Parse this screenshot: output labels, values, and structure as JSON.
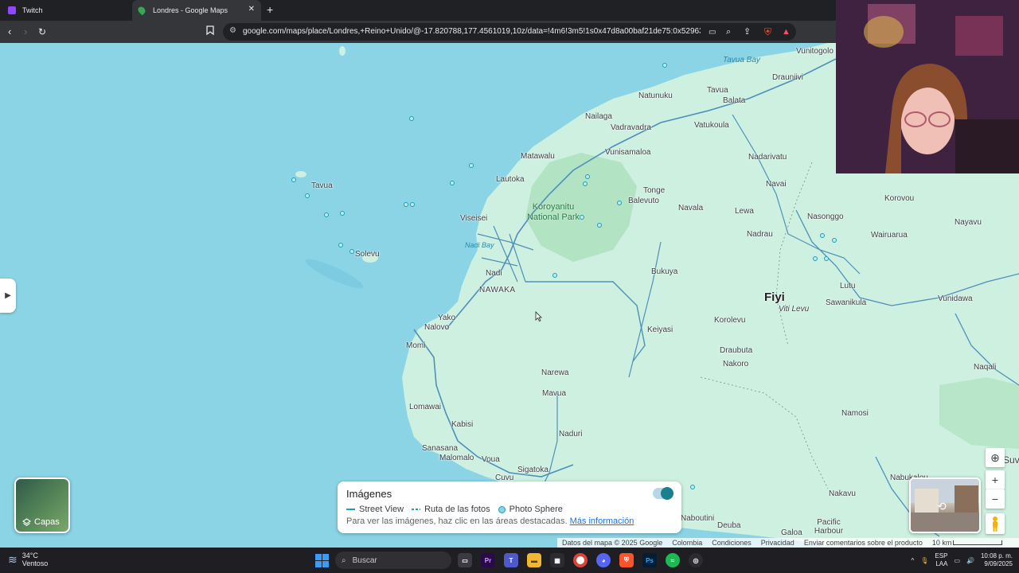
{
  "browser": {
    "tabs": [
      {
        "title": "Twitch",
        "active": false
      },
      {
        "title": "Londres - Google Maps",
        "active": true
      }
    ],
    "url": "google.com/maps/place/Londres,+Reino+Unido/@-17.820788,177.4561019,10z/data=!4m6!3m5!1s0x47d8a00baf21de75:0x52963a5addd..."
  },
  "map": {
    "country_label": "Fiyi",
    "island_label": "Viti Levu",
    "park_label": "Koroyanitu National Park",
    "water_labels": [
      "Tavua Bay",
      "Nadi Bay"
    ],
    "places": [
      "Vunitogolo",
      "Drauniivi",
      "Natunuku",
      "Tavua",
      "Balata",
      "Nailaga",
      "Vadravadra",
      "Vatukoula",
      "Matawalu",
      "Vunisamaloa",
      "Nadarivatu",
      "Tavua",
      "Lautoka",
      "Navai",
      "Tonge",
      "Balevuto",
      "Korovou",
      "Navala",
      "Viseisei",
      "Lewa",
      "Nasonggo",
      "Nayavu",
      "Wairuarua",
      "Nadrau",
      "Solevu",
      "Bukuya",
      "Nadi",
      "NAWAKA",
      "Lutu",
      "Sawanikula",
      "Vunidawa",
      "Yako",
      "Nalovo",
      "Korolevu",
      "Keiyasi",
      "Momi",
      "Draubuta",
      "Nakoro",
      "Naqali",
      "Narewa",
      "Mavua",
      "Namosi",
      "Lomawai",
      "Kabisi",
      "Naduri",
      "Sanasana",
      "Malomalo",
      "Voua",
      "Sigatoka",
      "Cuvu",
      "Nakavu",
      "Nabukalou",
      "Naboutini",
      "Deuba",
      "Galoa",
      "Pacific Harbour",
      "Suv"
    ]
  },
  "layers_button": {
    "label": "Capas"
  },
  "imagery_panel": {
    "title": "Imágenes",
    "toggle_on": true,
    "legend": [
      "Street View",
      "Ruta de las fotos",
      "Photo Sphere"
    ],
    "hint": "Para ver las imágenes, haz clic en las áreas destacadas.",
    "more_link": "Más información"
  },
  "attribution": [
    "Datos del mapa © 2025 Google",
    "Colombia",
    "Condiciones",
    "Privacidad",
    "Enviar comentarios sobre el producto",
    "10 km"
  ],
  "taskbar": {
    "weather_temp": "34°C",
    "weather_desc": "Ventoso",
    "search_placeholder": "Buscar",
    "lang_line1": "ESP",
    "lang_line2": "LAA",
    "time": "10:08 p. m.",
    "date": "9/09/2025"
  },
  "colors": {
    "water": "#8ad4e6",
    "land": "#cdf0e0",
    "park": "#a8dfb8",
    "road": "#4f8fb8",
    "accent": "#1a73e8"
  }
}
